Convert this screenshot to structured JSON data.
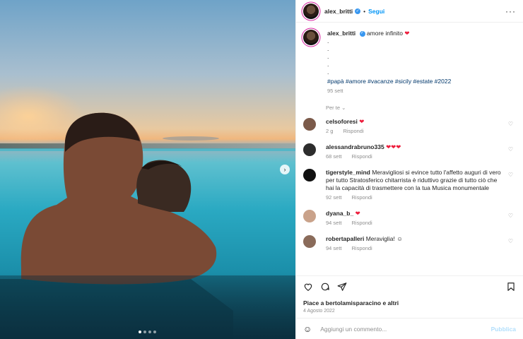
{
  "post": {
    "username": "alex_britti",
    "follow_label": "Segui",
    "separator": "•",
    "more_icon": "more-horizontal-icon"
  },
  "caption": {
    "username": "alex_britti",
    "text": "amore infinito",
    "dots": [
      ".",
      ".",
      ".",
      ".",
      "."
    ],
    "hashtags": "#papà #amore #vacanze #sicily #estate #2022",
    "time": "95 sett"
  },
  "sort_label": "Per te",
  "comments": [
    {
      "user": "celsoforesi",
      "text": "",
      "time": "2 g",
      "reply": "Rispondi",
      "avatar_color": "#7b5a4a"
    },
    {
      "user": "alessandrabruno335",
      "text": "",
      "time": "68 sett",
      "reply": "Rispondi",
      "avatar_color": "#2d2d2d"
    },
    {
      "user": "tigerstyle_mind",
      "text": "Meravigliosi si evince tutto l'affetto auguri di vero  per tutto Stratosferico chitarrista è riduttivo grazie di tutto ciò che hai la capacità di trasmettere con la tua Musica monumentale",
      "time": "92 sett",
      "reply": "Rispondi",
      "avatar_color": "#111111"
    },
    {
      "user": "dyana_b_",
      "text": "",
      "time": "94 sett",
      "reply": "Rispondi",
      "avatar_color": "#c9a28a"
    },
    {
      "user": "robertapalleri",
      "text": "Meraviglia!",
      "time": "94 sett",
      "reply": "Rispondi",
      "avatar_color": "#8a6b5a"
    }
  ],
  "likes_text": "Piace a bertolamisparacino e altri",
  "date": "4 Agosto 2022",
  "add_comment_placeholder": "Aggiungi un commento...",
  "publish_label": "Pubblica",
  "colors": {
    "accent": "#0095f6",
    "heart": "#ed1c3b",
    "tag": "#00376b",
    "muted": "#8e8e8e"
  }
}
